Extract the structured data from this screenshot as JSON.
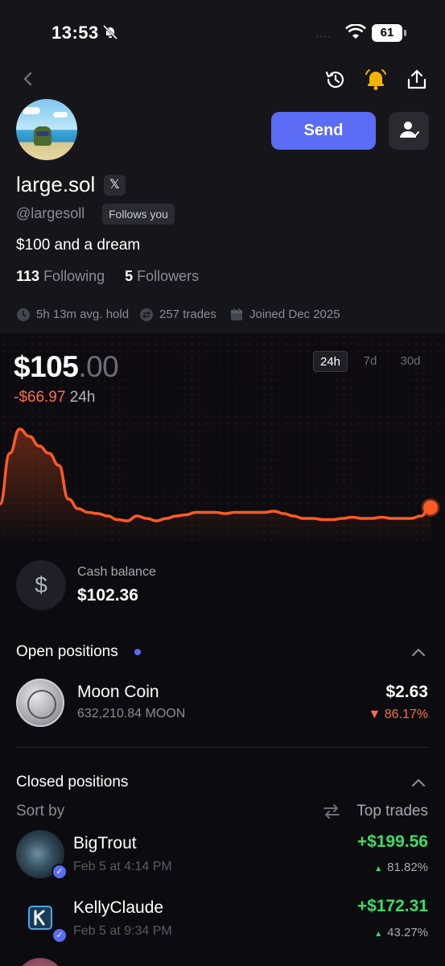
{
  "status_bar": {
    "time": "13:53",
    "signal": "....",
    "battery": "61"
  },
  "profile": {
    "name": "large.sol",
    "x_badge": "𝕏",
    "handle": "@largesoll",
    "follows_you": "Follows you",
    "bio": "$100 and a dream",
    "following_count": "113",
    "following_label": "Following",
    "followers_count": "5",
    "followers_label": "Followers",
    "avg_hold": "5h 13m avg. hold",
    "trades": "257 trades",
    "joined": "Joined Dec 2025"
  },
  "actions": {
    "send_label": "Send"
  },
  "portfolio": {
    "value_main": "$105",
    "value_cents": ".00",
    "change": "-$66.97",
    "change_period": "24h",
    "ranges": [
      "24h",
      "7d",
      "30d"
    ],
    "selected_range": "24h"
  },
  "chart_data": {
    "type": "line",
    "title": "",
    "xlabel": "",
    "ylabel": "",
    "color": "#ff5a24",
    "x": [
      0,
      1,
      2,
      3,
      4,
      5,
      6,
      7,
      8,
      9,
      10,
      11,
      12,
      13,
      14,
      15,
      16,
      17,
      18,
      19,
      20,
      21,
      22,
      23,
      24,
      25,
      26,
      27,
      28,
      29,
      30,
      31,
      32,
      33,
      34,
      35,
      36,
      37,
      38,
      39,
      40,
      41,
      42,
      43,
      44
    ],
    "values": [
      108,
      150,
      170,
      164,
      156,
      150,
      140,
      112,
      104,
      101,
      100,
      98,
      95,
      94,
      98,
      96,
      94,
      96,
      98,
      99,
      101,
      101,
      101,
      100,
      101,
      101,
      101,
      101,
      102,
      100,
      98,
      96,
      96,
      95,
      95,
      96,
      97,
      96,
      96,
      97,
      96,
      96,
      96,
      98,
      105
    ],
    "ylim": [
      80,
      180
    ]
  },
  "cash": {
    "label": "Cash balance",
    "value": "$102.36",
    "icon": "dollar-icon"
  },
  "open_positions": {
    "title": "Open positions",
    "items": [
      {
        "name": "Moon Coin",
        "amount": "632,210.84 MOON",
        "value": "$2.63",
        "change": "▼ 86.17%"
      }
    ]
  },
  "closed_positions": {
    "title": "Closed positions",
    "sort_label": "Sort by",
    "sort_value": "Top trades",
    "items": [
      {
        "name": "BigTrout",
        "date": "Feb 5 at 4:14 PM",
        "pnl": "+$199.56",
        "pct": "81.82%"
      },
      {
        "name": "KellyClaude",
        "date": "Feb 5 at 9:34 PM",
        "pnl": "+$172.31",
        "pct": "43.27%"
      }
    ]
  },
  "colors": {
    "accent": "#5b6cf6",
    "negative": "#ff6a4a",
    "positive": "#3ddc68",
    "chart_line": "#ff5a24"
  }
}
